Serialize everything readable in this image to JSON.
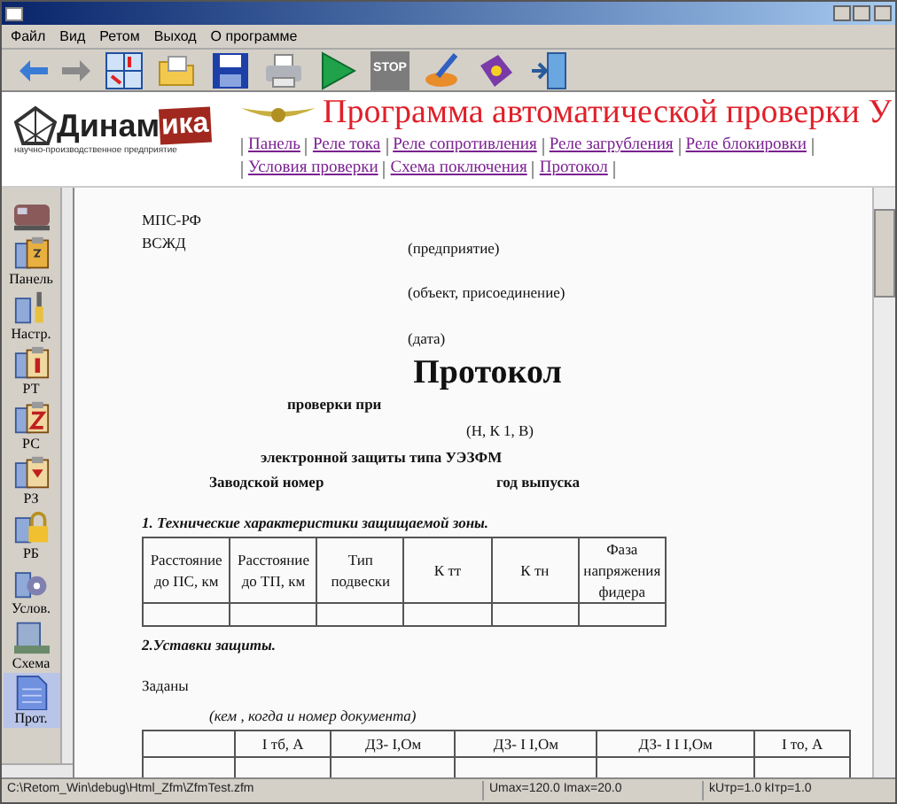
{
  "menu": [
    "Файл",
    "Вид",
    "Ретом",
    "Выход",
    "О программе"
  ],
  "toolbar": [
    {
      "kind": "back"
    },
    {
      "kind": "forward"
    },
    {
      "kind": "grid"
    },
    {
      "kind": "folder"
    },
    {
      "kind": "save"
    },
    {
      "kind": "print"
    },
    {
      "kind": "play"
    },
    {
      "kind": "stop",
      "label": "STOP"
    },
    {
      "kind": "brush"
    },
    {
      "kind": "help"
    },
    {
      "kind": "exit"
    }
  ],
  "header": {
    "logo": "Динам",
    "logo_accent": "ика",
    "logo_sub": "научно-производственное предприятие",
    "title": "Программа автоматической проверки У",
    "links": [
      [
        "Панель",
        "Реле тока",
        "Реле сопротивления",
        "Реле загрубления",
        "Реле блокировки"
      ],
      [
        "Условия проверки",
        "Схема поключения",
        "Протокол"
      ]
    ]
  },
  "sidebar": [
    {
      "kind": "train",
      "selected": false
    },
    {
      "kind": "panel",
      "label": "Панель",
      "selected": false
    },
    {
      "kind": "settings",
      "label": "Настр.",
      "selected": false
    },
    {
      "kind": "relay_i",
      "label": "РТ",
      "selected": false
    },
    {
      "kind": "relay_z",
      "label": "РС",
      "selected": false
    },
    {
      "kind": "relay_t",
      "label": "РЗ",
      "selected": false
    },
    {
      "kind": "lock",
      "label": "РБ",
      "selected": false
    },
    {
      "kind": "conditions",
      "label": "Услов.",
      "selected": false
    },
    {
      "kind": "scheme",
      "label": "Схема",
      "selected": false
    },
    {
      "kind": "doc",
      "label": "Прот.",
      "selected": true
    }
  ],
  "document": {
    "org": "МПС-РФ",
    "road": "ВСЖД",
    "hint_enterprise": "(предприятие)",
    "hint_object": "(объект, присоединение)",
    "hint_date": "(дата)",
    "title": "Протокол",
    "subtitle": "проверки при",
    "hint_mode": "(Н, К 1, В)",
    "device": "электронной защиты типа УЭЗФМ",
    "serial": "Заводской номер",
    "year": "год выпуска",
    "section1": "1. Технические характеристики защищаемой зоны.",
    "table1_columns": [
      "Расстояние до ПС, км",
      "Расстояние до ТП, км",
      "Тип подвески",
      "К тт",
      "К тн",
      "Фаза напряжения фидера"
    ],
    "section2": "2.Уставки защиты.",
    "given": "Заданы",
    "hint_given": "(кем , когда и номер документа)",
    "table2_columns": [
      "",
      "I тб, А",
      "ДЗ- I,Ом",
      "ДЗ- I I,Ом",
      "ДЗ- I I I,Ом",
      "I то, А"
    ]
  },
  "status_bar": [
    "C:\\Retom_Win\\debug\\Html_Zfm\\ZfmTest.zfm",
    "Umax=120.0 Imax=20.0",
    "kUтр=1.0 kIтр=1.0"
  ]
}
